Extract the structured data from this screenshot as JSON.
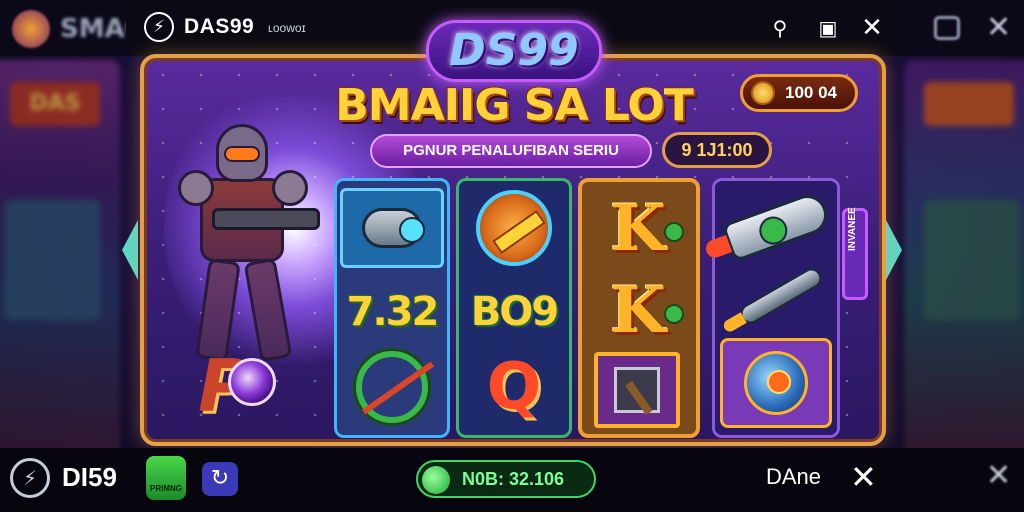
{
  "background": {
    "left_sign": "DAS",
    "top_blurred_title": "SMAG"
  },
  "header": {
    "brand": "DAS99",
    "brand_sub": "ʟᴏᴏᴡᴏɪ",
    "user_icon": "user-search-icon",
    "save_icon": "bookmark-icon",
    "close_icon": "close-icon"
  },
  "game": {
    "logo": "DS99",
    "title": "BMAIIG SA LOT",
    "subtitle": "PGNUR PENALUFIBAN SERIU",
    "stake": "9 1J1:00",
    "coin_balance": "100 04",
    "side_panel": "INVANEE"
  },
  "reels": {
    "r1_number": "7.32",
    "r2_number": "BO9",
    "r2_letter": "Q",
    "r3_letter": "K",
    "bonus_letter": "P"
  },
  "footer": {
    "brand": "DI59",
    "app1_label": "PRIMNG",
    "balance": "N0B: 32.106",
    "done_label": "DAne"
  },
  "colors": {
    "accent_gold": "#f0a030",
    "accent_purple": "#c45cff",
    "accent_green": "#3ad86a"
  }
}
